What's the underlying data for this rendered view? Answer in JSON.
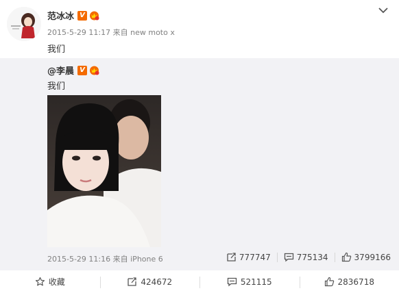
{
  "post": {
    "author": "范冰冰",
    "verified_mark": "V",
    "timestamp": "2015-5-29 11:17",
    "source_prefix": "来自",
    "source": "new moto x",
    "text": "我们"
  },
  "retweet": {
    "author": "@李晨",
    "verified_mark": "V",
    "text": "我们",
    "timestamp": "2015-5-29 11:16",
    "source_prefix": "来自",
    "source": "iPhone 6",
    "reposts": "777747",
    "comments": "775134",
    "likes": "3799166"
  },
  "actions": {
    "favorite": "收藏",
    "reposts": "424672",
    "comments": "521115",
    "likes": "2836718"
  },
  "icons": {
    "expand": "chevron-down-icon",
    "repost": "repost-icon",
    "comment": "comment-icon",
    "like": "thumbs-up-icon",
    "favorite": "star-icon"
  },
  "colors": {
    "verified": "#f46b00",
    "retweet_bg": "#f2f2f5",
    "meta": "#808080"
  }
}
